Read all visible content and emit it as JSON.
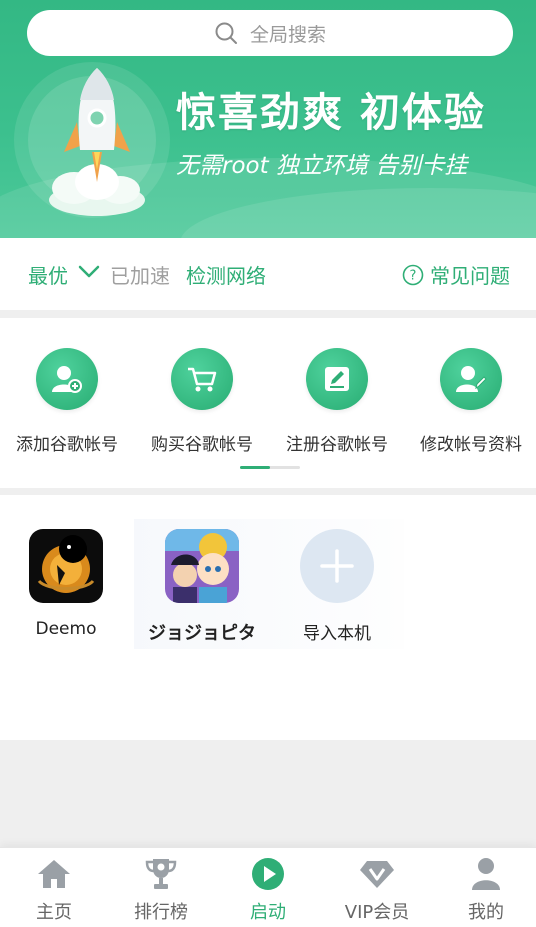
{
  "search": {
    "placeholder": "全局搜索"
  },
  "banner": {
    "title": "惊喜劲爽  初体验",
    "subtitle": "无需root  独立环境  告别卡挂"
  },
  "network": {
    "mode": "最优",
    "status": "已加速",
    "check": "检测网络",
    "faq": "常见问题"
  },
  "shortcuts": [
    {
      "label": "添加谷歌帐号",
      "icon": "add-user-icon"
    },
    {
      "label": "购买谷歌帐号",
      "icon": "cart-icon"
    },
    {
      "label": "注册谷歌帐号",
      "icon": "edit-icon"
    },
    {
      "label": "修改帐号资料",
      "icon": "edit-user-icon"
    }
  ],
  "apps": [
    {
      "name": "Deemo"
    },
    {
      "name": "ジョジョピタ"
    },
    {
      "name": "导入本机"
    }
  ],
  "tabs": [
    {
      "label": "主页",
      "icon": "home-icon"
    },
    {
      "label": "排行榜",
      "icon": "trophy-icon"
    },
    {
      "label": "启动",
      "icon": "play-icon",
      "active": true
    },
    {
      "label": "VIP会员",
      "icon": "diamond-icon"
    },
    {
      "label": "我的",
      "icon": "person-icon"
    }
  ],
  "colors": {
    "accent": "#2fae76",
    "banner": "#3cc08e",
    "inactive_tab": "#9aa0a6"
  }
}
